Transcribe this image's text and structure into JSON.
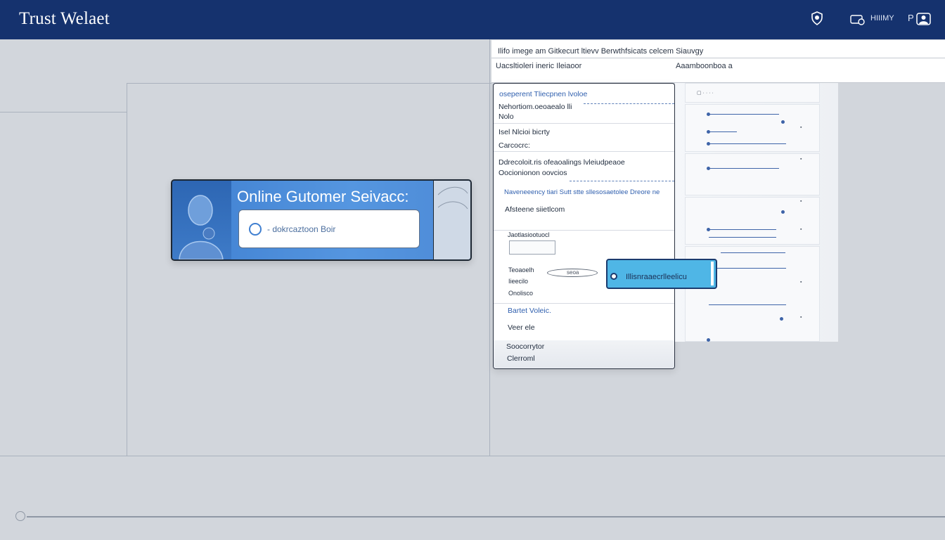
{
  "header": {
    "brand": "Trust Welaet",
    "icons": [
      "shield-icon",
      "card-icon",
      "profile-badge-icon"
    ],
    "nav_text": "HIIIMY",
    "profile_letter": "P"
  },
  "widget": {
    "title": "Online Gutomer Seivacc:",
    "field_label": "- dokrcaztoon Boir"
  },
  "detail_header": {
    "row1": "Ilifo imege am  Gitkecurt ltievv  Berwthfsicats celcem Siauvgy",
    "row2_left": "Uacsltioleri ineric Ileiaoor",
    "row2_right": "Aaamboonboa a"
  },
  "form": {
    "item1": "oseperent Tliecpnen lvoloe",
    "item2": "Nehortiom.oeoaealo lli",
    "item3": "Nolo",
    "item4": "Isel Nlcioi bicrty",
    "item5": "Carcocrc:",
    "item6": "Ddrecoloit.ris ofeaoalings lvleiudpeaoe",
    "item7": "Oocionionon oovcios",
    "item8": "Naveneeency tiari Sutt stte sllesosaetolee Dreore ne",
    "item9": "Afsteene  siietlcom",
    "item10": "Jaotlasiootuocl",
    "item11": "Teoaoelh",
    "item12": "Iieecilo",
    "item13": "Onolisco",
    "oval_label": "seoa",
    "item14": "Bartet Voleic.",
    "item15": "Veer ele",
    "item16": "Soocorrytor",
    "item17": "Clerroml"
  },
  "cta": {
    "label": "Illisnraaecrlleelicu"
  },
  "colors": {
    "topbar": "#15326e",
    "accent": "#4fb6e6",
    "widget_blue": "#4d8ad6",
    "background": "#d2d6dc"
  }
}
